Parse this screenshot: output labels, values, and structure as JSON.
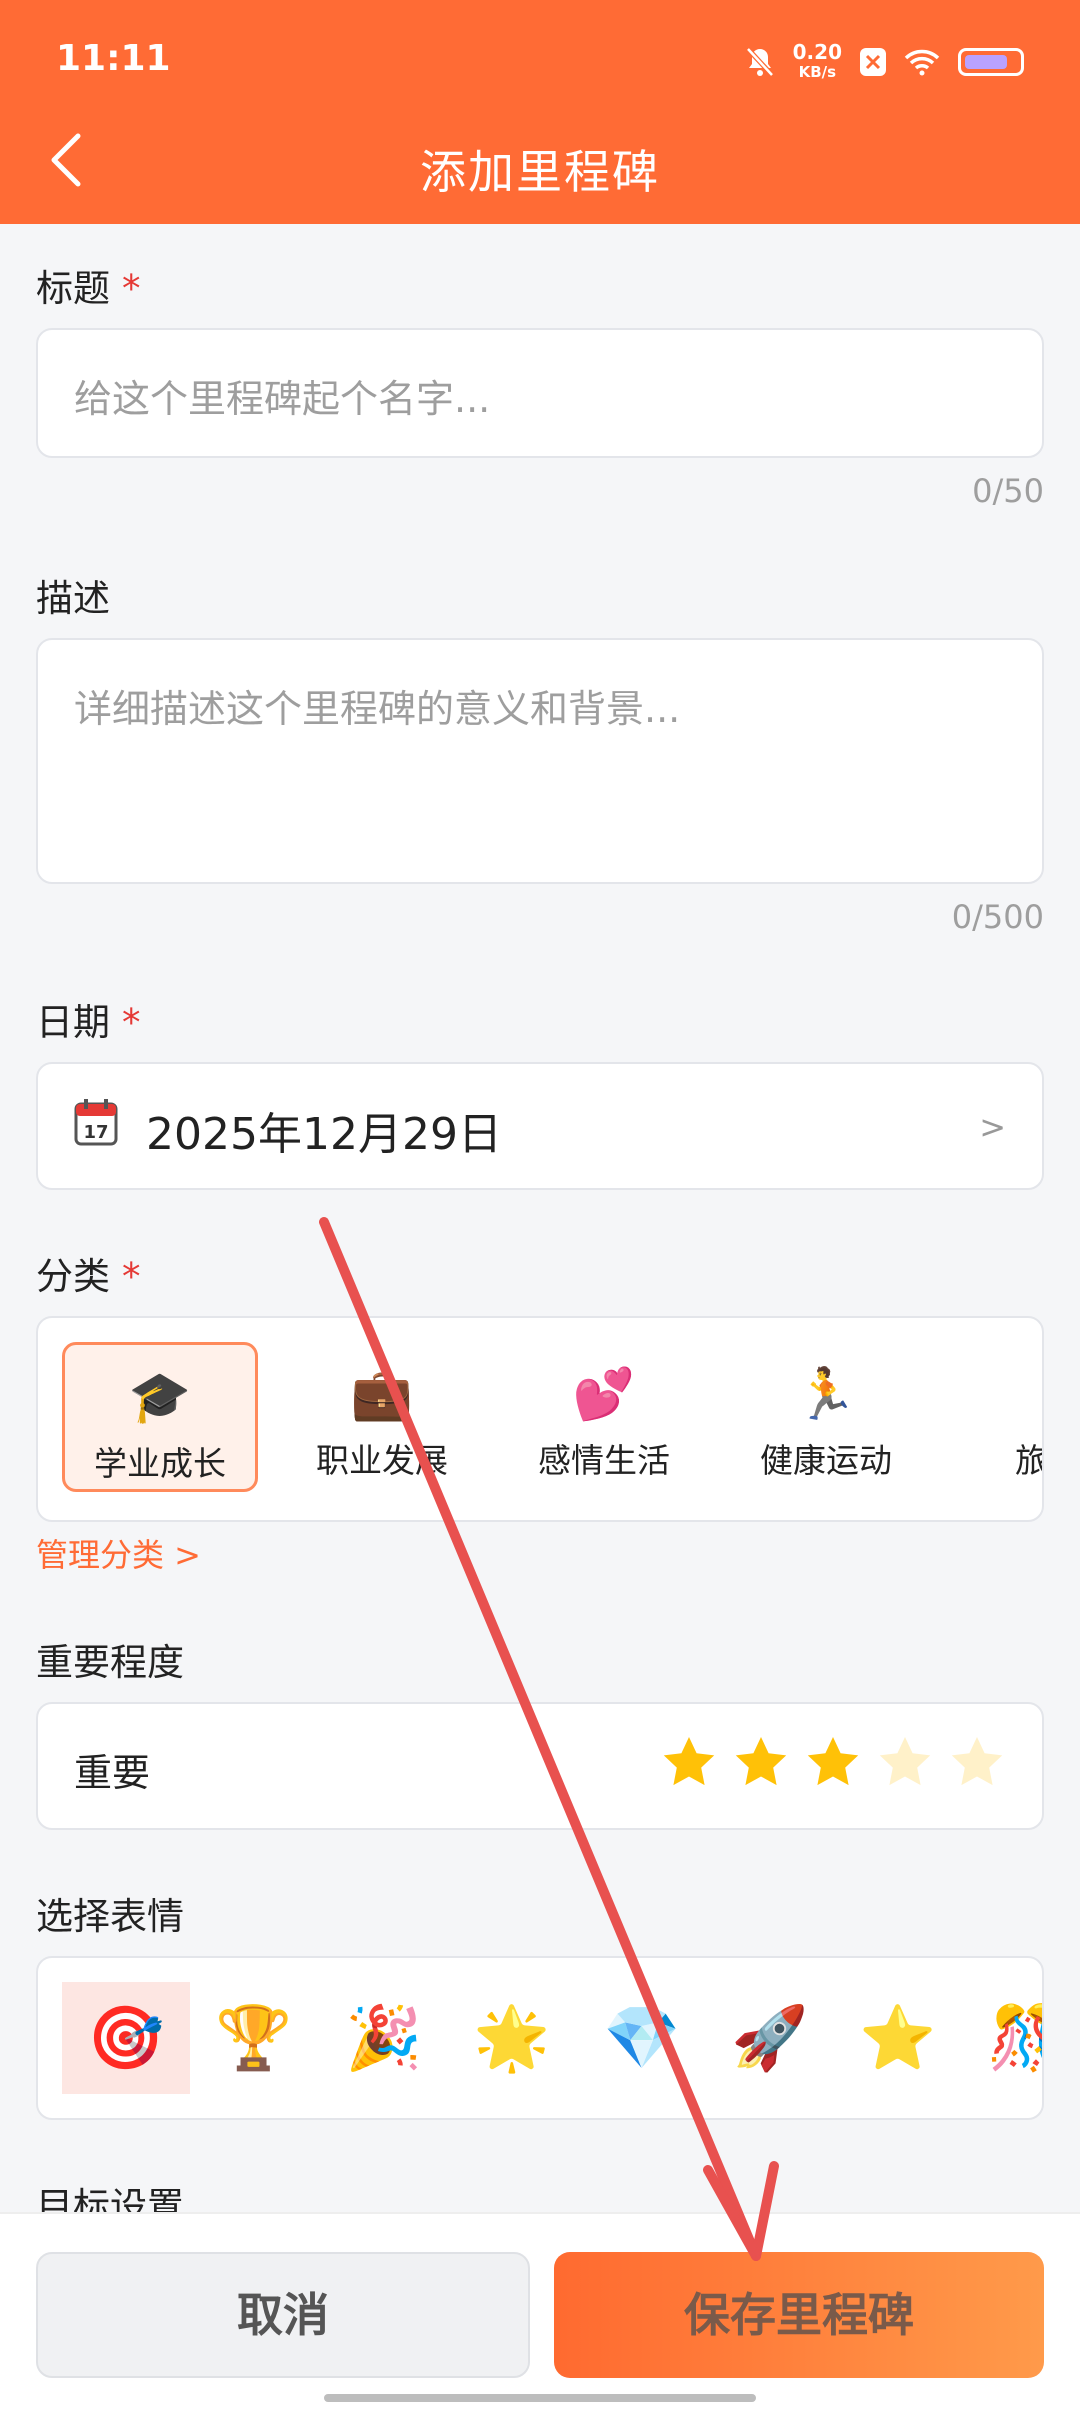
{
  "status": {
    "time": "11:11",
    "speed_top": "0.20",
    "speed_unit": "KB/s",
    "battery_level": 0.8
  },
  "header": {
    "title": "添加里程碑"
  },
  "title_field": {
    "label": "标题",
    "required": "*",
    "placeholder": "给这个里程碑起个名字...",
    "counter": "0/50"
  },
  "description_field": {
    "label": "描述",
    "placeholder": "详细描述这个里程碑的意义和背景...",
    "counter": "0/500"
  },
  "date_field": {
    "label": "日期",
    "required": "*",
    "value": "2025年12月29日",
    "arrow": ">"
  },
  "category_field": {
    "label": "分类",
    "required": "*",
    "items": [
      {
        "emoji": "🎓",
        "label": "学业成长"
      },
      {
        "emoji": "💼",
        "label": "职业发展"
      },
      {
        "emoji": "💕",
        "label": "感情生活"
      },
      {
        "emoji": "🏃",
        "label": "健康运动"
      },
      {
        "emoji": "",
        "label": "旅行"
      }
    ],
    "selected_index": 0,
    "manage_link": "管理分类 >"
  },
  "importance_field": {
    "label": "重要程度",
    "value_label": "重要",
    "rating": 3,
    "max": 5
  },
  "emoji_field": {
    "label": "选择表情",
    "items": [
      "🎯",
      "🏆",
      "🎉",
      "🌟",
      "💎",
      "🚀",
      "⭐",
      "🎊"
    ],
    "selected_index": 0
  },
  "goal_field": {
    "label": "目标设置"
  },
  "actions": {
    "cancel": "取消",
    "save": "保存里程碑"
  },
  "colors": {
    "brand": "#ff6b35",
    "required": "#e53935",
    "star": "#ffc107",
    "annotation_arrow": "#e8514f"
  }
}
